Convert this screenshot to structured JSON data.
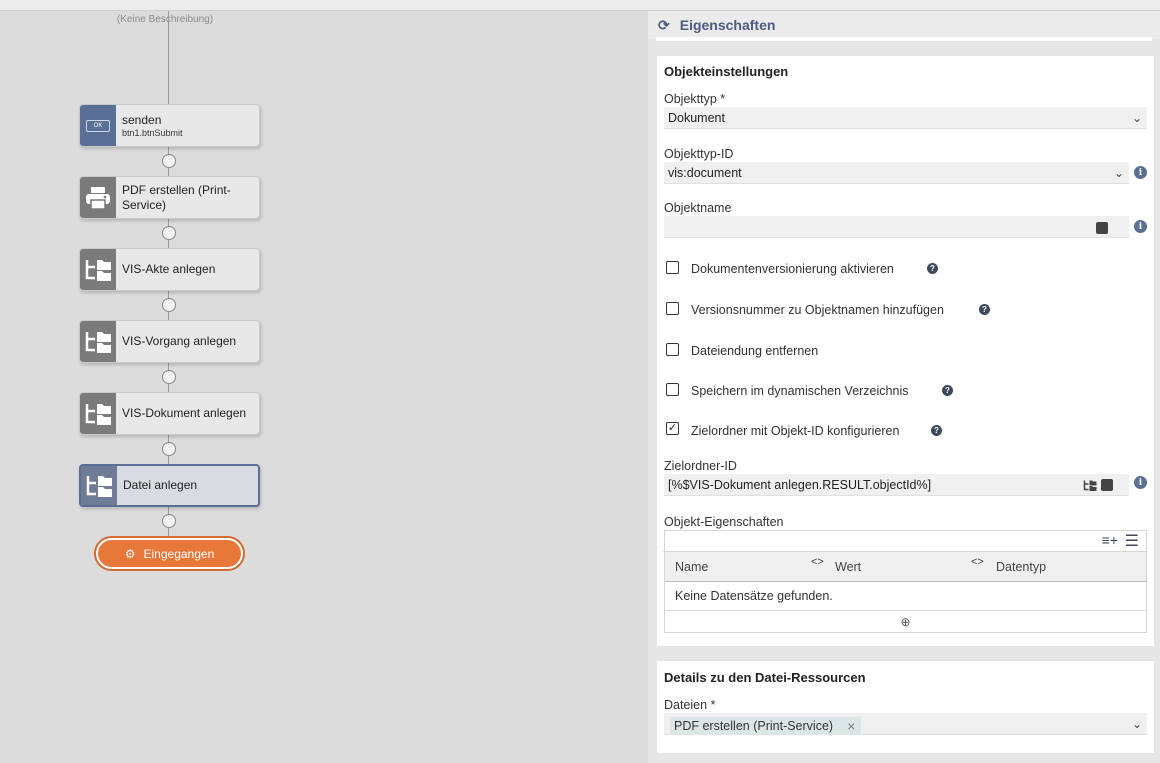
{
  "canvas": {
    "description": "(Keine Beschreibung)",
    "nodes": [
      {
        "title": "senden",
        "subtitle": "btn1.btnSubmit",
        "icon": "ok-button-icon",
        "ok_label": "OK"
      },
      {
        "title": "PDF erstellen (Print-Service)",
        "icon": "printer-icon"
      },
      {
        "title": "VIS-Akte anlegen",
        "icon": "folder-tree-icon"
      },
      {
        "title": "VIS-Vorgang anlegen",
        "icon": "folder-tree-icon"
      },
      {
        "title": "VIS-Dokument anlegen",
        "icon": "folder-tree-icon"
      },
      {
        "title": "Datei anlegen",
        "icon": "folder-tree-icon"
      }
    ],
    "end_node": {
      "label": "Eingegangen",
      "icon": "gears-icon"
    }
  },
  "panel": {
    "title": "Eigenschaften",
    "section1": {
      "heading": "Objekteinstellungen",
      "objekttyp": {
        "label": "Objekttyp",
        "required_mark": "*",
        "value": "Dokument"
      },
      "objekttyp_id": {
        "label": "Objekttyp-ID",
        "value": "vis:document"
      },
      "objektname": {
        "label": "Objektname",
        "value": ""
      },
      "checkboxes": [
        {
          "label": "Dokumentenversionierung aktivieren",
          "checked": false,
          "help": true
        },
        {
          "label": "Versionsnummer zu Objektnamen hinzufügen",
          "checked": false,
          "help": true
        },
        {
          "label": "Dateiendung entfernen",
          "checked": false,
          "help": false
        },
        {
          "label": "Speichern im dynamischen Verzeichnis",
          "checked": false,
          "help": true
        },
        {
          "label": "Zielordner mit Objekt-ID konfigurieren",
          "checked": true,
          "help": true
        }
      ],
      "zielordner_id": {
        "label": "Zielordner-ID",
        "value": "[%$VIS-Dokument anlegen.RESULT.objectId%]"
      },
      "objekt_eigenschaften": {
        "label": "Objekt-Eigenschaften",
        "columns": [
          "Name",
          "Wert",
          "Datentyp"
        ],
        "empty_text": "Keine Datensätze gefunden."
      }
    },
    "section2": {
      "heading": "Details zu den Datei-Ressourcen",
      "dateien": {
        "label": "Dateien",
        "required_mark": "*",
        "tags": [
          "PDF erstellen (Print-Service)"
        ]
      }
    }
  },
  "colors": {
    "accent": "#5a6f96",
    "end_node": "#e8773a",
    "panel_title": "#4b5d80"
  }
}
